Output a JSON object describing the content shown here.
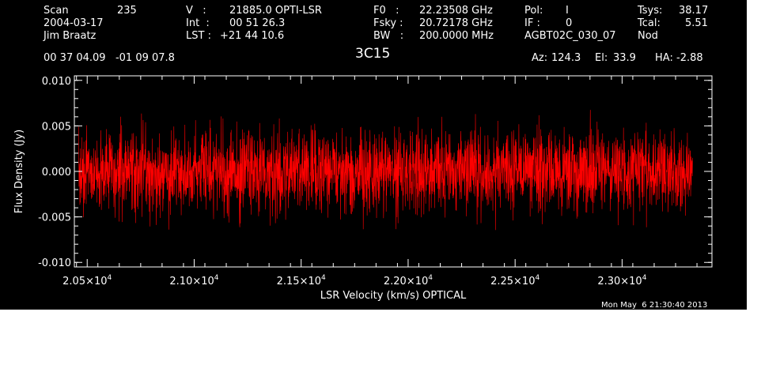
{
  "header": {
    "scan_label": "Scan",
    "scan_value": "235",
    "date": "2004-03-17",
    "observer": "Jim Braatz",
    "v_label": "V   :",
    "v_value": "21885.0 OPTI-LSR",
    "int_label": "Int  :",
    "int_value": "00 51 26.3",
    "lst_label": "LST :",
    "lst_value": "+21 44 10.6",
    "f0_label": "F0   :",
    "f0_value": "22.23508 GHz",
    "fsky_label": "Fsky :",
    "fsky_value": "20.72178 GHz",
    "bw_label": "BW   :",
    "bw_value": "200.0000 MHz",
    "pol_label": "Pol:",
    "pol_value": "I",
    "if_label": "IF :",
    "if_value": "0",
    "project": "AGBT02C_030_07",
    "tsys_label": "Tsys:",
    "tsys_value": "38.17",
    "tcal_label": "Tcal:",
    "tcal_value": "5.51",
    "mode": "Nod",
    "coords": "00 37 04.09   -01 09 07.8",
    "source": "3C15",
    "az_label": "Az:",
    "az_value": "124.3",
    "el_label": "El:",
    "el_value": "33.9",
    "ha_label": "HA:",
    "ha_value": "-2.88"
  },
  "footer": {
    "timestamp": "Mon May  6 21:30:40 2013"
  },
  "chart_data": {
    "type": "line",
    "xlabel": "LSR Velocity (km/s) OPTICAL",
    "ylabel": "Flux Density (Jy)",
    "xlim": [
      20440,
      23420
    ],
    "ylim": [
      -0.0105,
      0.0105
    ],
    "x_range_data": [
      20460,
      23330
    ],
    "x_ticks": [
      20500,
      21000,
      21500,
      22000,
      22500,
      23000
    ],
    "x_tick_mantissas": [
      "2.05",
      "2.10",
      "2.15",
      "2.20",
      "2.25",
      "2.30"
    ],
    "x_tick_exponent": "4",
    "y_ticks": [
      -0.01,
      -0.005,
      0.0,
      0.005,
      0.01
    ],
    "y_tick_labels": [
      "-0.010",
      "-0.005",
      "0.000",
      "0.005",
      "0.010"
    ],
    "series": [
      {
        "color": "#ff0000",
        "noise_rms": 0.0022,
        "mean": 0.0,
        "peak_max": 0.0075,
        "peak_min": -0.0077
      }
    ]
  }
}
